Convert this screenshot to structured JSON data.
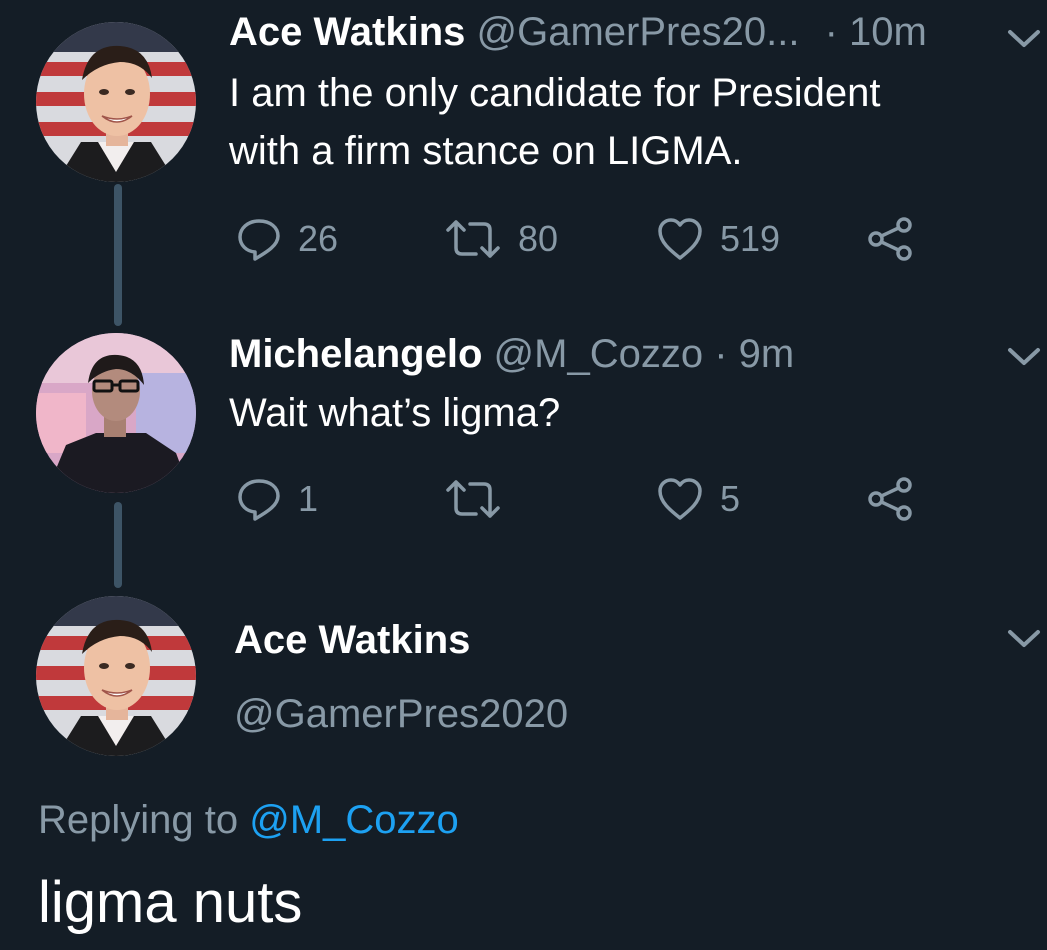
{
  "tweets": [
    {
      "name": "Ace Watkins",
      "handle": "@GamerPres20...",
      "separator": "·",
      "time": "10m",
      "text": "I am the only candidate for President\nwith a firm stance on LIGMA.",
      "reply_count": "26",
      "retweet_count": "80",
      "like_count": "519"
    },
    {
      "name": "Michelangelo",
      "handle": "@M_Cozzo",
      "separator": "·",
      "time": "9m",
      "text": "Wait what’s ligma?",
      "reply_count": "1",
      "retweet_count": "",
      "like_count": "5"
    }
  ],
  "detail": {
    "name": "Ace Watkins",
    "handle": "@GamerPres2020",
    "replying_prefix": "Replying to",
    "replying_mention": "@M_Cozzo",
    "text": "ligma nuts"
  },
  "icons": {
    "reply": "reply-icon",
    "retweet": "retweet-icon",
    "like": "heart-icon",
    "share": "share-icon",
    "menu": "chevron-down-icon"
  },
  "colors": {
    "background": "#141d26",
    "secondary_text": "#8899a6",
    "mention": "#1da1f2",
    "thread_line": "#3d5466"
  }
}
